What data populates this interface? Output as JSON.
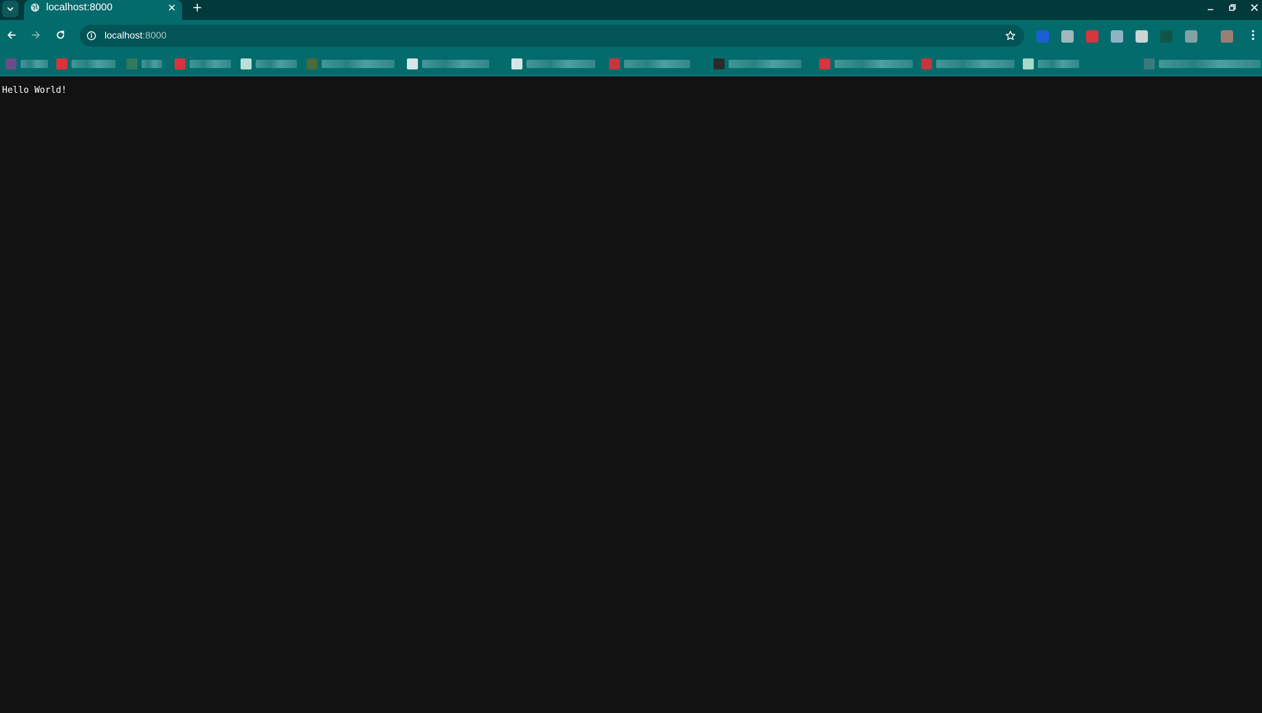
{
  "browser": {
    "tab": {
      "title": "localhost:8000",
      "favicon": "globe-icon"
    },
    "address_bar": {
      "host": "localhost",
      "port": ":8000"
    },
    "colors": {
      "tab_strip": "#02393b",
      "toolbar": "#046b6d",
      "omnibox": "#035456",
      "page_background": "#121212"
    },
    "icons": {
      "tab_search": "chevron-down-icon",
      "tab_close": "close-icon",
      "new_tab": "plus-icon",
      "back": "arrow-left-icon",
      "forward": "arrow-right-icon",
      "reload": "reload-icon",
      "site_info": "info-icon",
      "bookmark": "star-icon",
      "menu": "kebab-menu-icon",
      "minimize": "minimize-icon",
      "maximize": "restore-icon",
      "close_window": "close-icon"
    },
    "extensions": [
      {
        "color": "#1a5fd1"
      },
      {
        "color": "#9fb8b9"
      },
      {
        "color": "#d8343d"
      },
      {
        "color": "#8fb2c4"
      },
      {
        "color": "#c9d5d6"
      },
      {
        "color": "#0e5748"
      },
      {
        "color": "#7fa3a4"
      },
      {
        "color": "#9a7f74"
      }
    ],
    "bookmarks": [
      {
        "favicon_color": "#6a4c8a"
      },
      {
        "favicon_color": "#d8343d"
      },
      {
        "favicon_color": "#2f7a5c"
      },
      {
        "favicon_color": "#d8343d"
      },
      {
        "favicon_color": "#b8e0d8"
      },
      {
        "favicon_color": "#4a6b3a"
      },
      {
        "favicon_color": "#d6e6e6"
      },
      {
        "favicon_color": "#d6e6e6"
      },
      {
        "favicon_color": "#c8343d"
      },
      {
        "favicon_color": "#2a2a2a"
      },
      {
        "favicon_color": "#d8343d"
      },
      {
        "favicon_color": "#c8343d"
      },
      {
        "favicon_color": "#a8d8c8"
      },
      {
        "favicon_color": "#3a7a7c"
      }
    ]
  },
  "page": {
    "text": "Hello World!"
  }
}
